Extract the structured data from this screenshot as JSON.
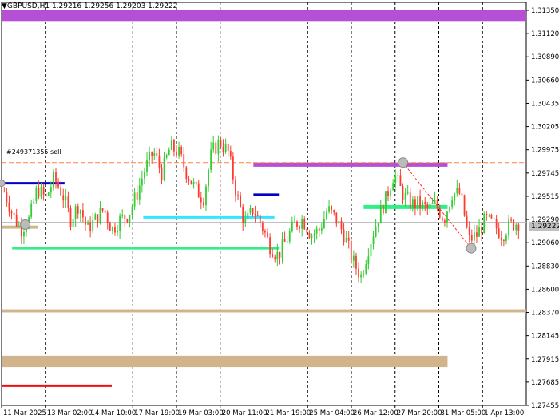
{
  "header": {
    "menu_icon": "triangle-down-icon",
    "symbol_line": "GBPUSD,H1  1.29216 1.29256 1.29203 1.29222"
  },
  "order_label": "#249371355 sell",
  "current_price": "1.29222",
  "colors": {
    "background": "#ffffff",
    "grid": "#000000",
    "bull": "#32cd32",
    "bear": "#ff3b30",
    "magenta": "#b44fd6",
    "navy": "#0000c8",
    "cyan": "#33e6ff",
    "green_line": "#33ee88",
    "tan": "#d2b48c",
    "red_line": "#ee1111",
    "order_line": "#ff8040"
  },
  "chart_data": {
    "type": "candlestick",
    "symbol": "GBPUSD",
    "timeframe": "H1",
    "ylim": [
      1.2745,
      1.3135
    ],
    "y_ticks": [
      "1.31350",
      "1.31120",
      "1.30890",
      "1.30660",
      "1.30435",
      "1.30205",
      "1.29975",
      "1.29745",
      "1.29515",
      "1.29290",
      "1.29060",
      "1.28830",
      "1.28600",
      "1.28370",
      "1.28145",
      "1.27915",
      "1.27685",
      "1.27455"
    ],
    "x_ticks": [
      "11 Mar 2025",
      "13 Mar 02:00",
      "14 Mar 10:00",
      "17 Mar 19:00",
      "19 Mar 03:00",
      "20 Mar 11:00",
      "21 Mar 19:00",
      "25 Mar 04:00",
      "26 Mar 12:00",
      "27 Mar 20:00",
      "31 Mar 05:00",
      "1 Apr 13:00"
    ],
    "price_path": [
      1.2952,
      1.293,
      1.2915,
      1.2925,
      1.2955,
      1.2945,
      1.2965,
      1.295,
      1.2925,
      1.294,
      1.2915,
      1.2925,
      1.2935,
      1.2915,
      1.2925,
      1.293,
      1.295,
      1.2975,
      1.299,
      1.297,
      1.2995,
      1.299,
      1.297,
      1.2955,
      1.2945,
      1.299,
      1.3,
      1.299,
      1.295,
      1.292,
      1.2935,
      1.292,
      1.29,
      1.289,
      1.2905,
      1.292,
      1.2925,
      1.291,
      1.2915,
      1.2935,
      1.2925,
      1.291,
      1.2885,
      1.287,
      1.29,
      1.2925,
      1.2945,
      1.297,
      1.295,
      1.294,
      1.294,
      1.2935,
      1.294,
      1.2925,
      1.295,
      1.295,
      1.2905,
      1.291,
      1.2925,
      1.292,
      1.291,
      1.292,
      1.2922
    ],
    "current_price": 1.29222,
    "zones": [
      {
        "name": "magenta-top-zone",
        "price_top": 1.3128,
        "price_bottom": 1.3117,
        "t_start": 0.0,
        "t_end": 1.0,
        "color": "#b44fd6"
      },
      {
        "name": "magenta-mid-zone",
        "price_top": 1.298,
        "price_bottom": 1.2976,
        "t_start": 0.48,
        "t_end": 0.85,
        "color": "#b44fd6"
      },
      {
        "name": "tan-left-zone",
        "price_top": 1.2919,
        "price_bottom": 1.2916,
        "t_start": 0.0,
        "t_end": 0.07,
        "color": "#d2b48c"
      },
      {
        "name": "tan-mid-zone",
        "price_top": 1.2838,
        "price_bottom": 1.2835,
        "t_start": 0.0,
        "t_end": 1.0,
        "color": "#d2b48c"
      },
      {
        "name": "tan-low-zone",
        "price_top": 1.2793,
        "price_bottom": 1.2782,
        "t_start": 0.0,
        "t_end": 0.85,
        "color": "#d2b48c"
      }
    ],
    "lines": [
      {
        "name": "navy-left-line",
        "price": 1.296,
        "t_start": 0.0,
        "t_end": 0.12,
        "color": "#0000c8",
        "width": 3
      },
      {
        "name": "navy-mid-line",
        "price": 1.2949,
        "t_start": 0.48,
        "t_end": 0.53,
        "color": "#0000c8",
        "width": 3
      },
      {
        "name": "cyan-line",
        "price": 1.2927,
        "t_start": 0.27,
        "t_end": 0.52,
        "color": "#33e6ff",
        "width": 3
      },
      {
        "name": "green-lower-line",
        "price": 1.2897,
        "t_start": 0.02,
        "t_end": 0.53,
        "color": "#33ee88",
        "width": 3
      },
      {
        "name": "green-right-line",
        "price": 1.2937,
        "t_start": 0.69,
        "t_end": 0.85,
        "color": "#33ee88",
        "width": 5
      },
      {
        "name": "red-bottom-line",
        "price": 1.2764,
        "t_start": 0.0,
        "t_end": 0.21,
        "color": "#ee1111",
        "width": 3
      },
      {
        "name": "order-line",
        "price": 1.298,
        "t_start": 0.0,
        "t_end": 1.0,
        "color": "#ff8040",
        "width": 1,
        "dash": true
      },
      {
        "name": "current-price-line",
        "price": 1.29222,
        "t_start": 0.0,
        "t_end": 1.0,
        "color": "#c0c0c0",
        "width": 1
      }
    ]
  }
}
